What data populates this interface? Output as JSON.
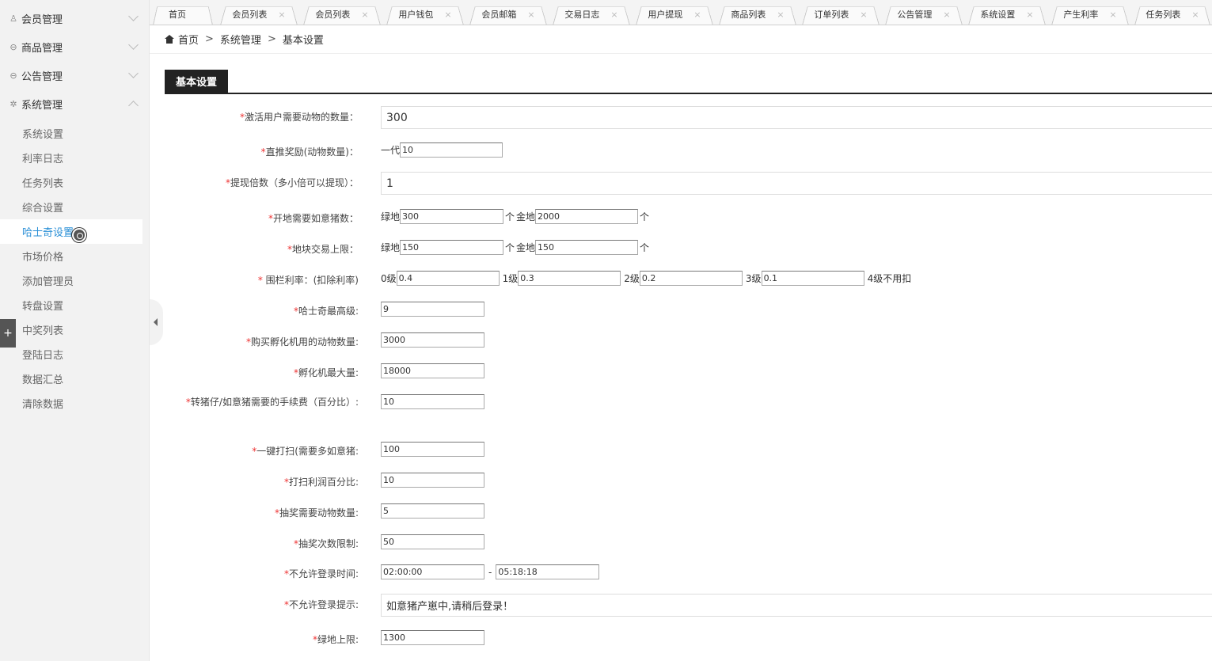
{
  "sidebar": {
    "groups": [
      {
        "label": "会员管理",
        "icon": "user-icon"
      },
      {
        "label": "商品管理",
        "icon": "circle-minus-icon"
      },
      {
        "label": "公告管理",
        "icon": "circle-minus-icon"
      },
      {
        "label": "系统管理",
        "icon": "gear-icon"
      }
    ],
    "items": [
      "系统设置",
      "利率日志",
      "任务列表",
      "综合设置",
      "哈士奇设置",
      "市场价格",
      "添加管理员",
      "转盘设置",
      "中奖列表",
      "登陆日志",
      "数据汇总",
      "清除数据"
    ],
    "collapse_glyph": "+"
  },
  "tabs": [
    {
      "label": "首页",
      "close": ""
    },
    {
      "label": "会员列表",
      "close": "×"
    },
    {
      "label": "会员列表",
      "close": "×"
    },
    {
      "label": "用户钱包",
      "close": "×"
    },
    {
      "label": "会员邮箱",
      "close": "×"
    },
    {
      "label": "交易日志",
      "close": "×"
    },
    {
      "label": "用户提现",
      "close": "×"
    },
    {
      "label": "商品列表",
      "close": "×"
    },
    {
      "label": "订单列表",
      "close": "×"
    },
    {
      "label": "公告管理",
      "close": "×"
    },
    {
      "label": "系统设置",
      "close": "×"
    },
    {
      "label": "产生利率",
      "close": "×"
    },
    {
      "label": "任务列表",
      "close": "×"
    }
  ],
  "breadcrumb": {
    "home": "首页",
    "sep": ">",
    "level1": "系统管理",
    "level2": "基本设置"
  },
  "section_title": "基本设置",
  "form": {
    "req_mark": "*",
    "activate_label": "激活用户需要动物的数量：",
    "activate_value": "300",
    "direct_label": "直推奖励(动物数量)：",
    "direct_prefix": "一代",
    "direct_value": "10",
    "withdraw_label": "提现倍数（多小倍可以提现）：",
    "withdraw_value": "1",
    "open_label": "开地需要如意猪数：",
    "green_prefix": "绿地",
    "open_green": "300",
    "unit": "个",
    "gold_prefix": "金地",
    "open_gold": "2000",
    "trade_label": "地块交易上限：",
    "trade_green": "150",
    "trade_gold": "150",
    "fence_label": " 围栏利率：(扣除利率)",
    "lv0": "0级",
    "lv0_value": "0.4",
    "lv1": "1级",
    "lv1_value": "0.3",
    "lv2": "2级",
    "lv2_value": "0.2",
    "lv3": "3级",
    "lv3_value": "0.1",
    "lv4_text": "4级不用扣",
    "husky_label": "哈士奇最高级:",
    "husky_value": "9",
    "incubator_label": "购买孵化机用的动物数量:",
    "incubator_value": "3000",
    "incubator_max_label": "孵化机最大量:",
    "incubator_max_value": "18000",
    "fee_label": "转猪仔/如意猪需要的手续费（百分比）:",
    "fee_value": "10",
    "sweep_label": "一键打扫(需要多如意猪:",
    "sweep_value": "100",
    "sweep_profit_label": "打扫利润百分比:",
    "sweep_profit_value": "10",
    "lottery_need_label": "抽奖需要动物数量:",
    "lottery_need_value": "5",
    "lottery_limit_label": "抽奖次数限制:",
    "lottery_limit_value": "50",
    "nologin_time_label": "不允许登录时间:",
    "nologin_start": "02:00:00",
    "time_sep": "-",
    "nologin_end": "05:18:18",
    "nologin_msg_label": "不允许登录提示:",
    "nologin_msg_value": "如意猪产崽中,请稍后登录！",
    "green_limit_label": "绿地上限:",
    "green_limit_value": "1300"
  }
}
